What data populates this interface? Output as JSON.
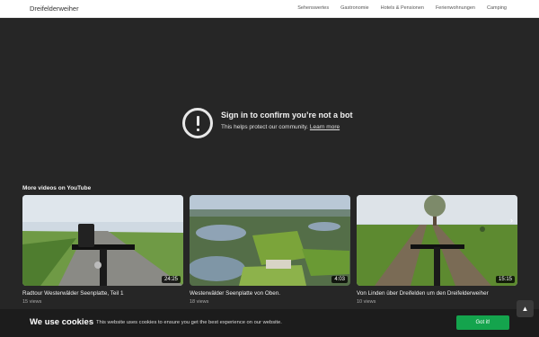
{
  "site": {
    "brand": "Dreifelderweiher"
  },
  "nav": {
    "items": [
      "Sehenswertes",
      "Gastronomie",
      "Hotels & Pensionen",
      "Ferienwohnungen",
      "Camping"
    ]
  },
  "player": {
    "message_title": "Sign in to confirm you’re not a bot",
    "message_sub": "This helps protect our community.",
    "learn_more": "Learn more",
    "more_videos_label": "More videos on YouTube",
    "videos": [
      {
        "title": "Radtour Westerwälder Seenplatte, Teil 1",
        "views": "15 views",
        "duration": "24:25"
      },
      {
        "title": "Westerwälder Seenplatte von Oben.",
        "views": "18 views",
        "duration": "4:03"
      },
      {
        "title": "Von Linden über Dreifelden um den Dreifelderweiher",
        "views": "10 views",
        "duration": "15:15"
      }
    ]
  },
  "cookie": {
    "title": "We use cookies",
    "text": "This website uses cookies to ensure you get the best experience on our website.",
    "button": "Got it!"
  },
  "colors": {
    "accept": "#14a44d",
    "background": "#262626"
  },
  "icons": {
    "warning": "exclamation-circle-icon",
    "next": "chevron-right-icon",
    "scroll_top": "chevron-up-icon"
  }
}
